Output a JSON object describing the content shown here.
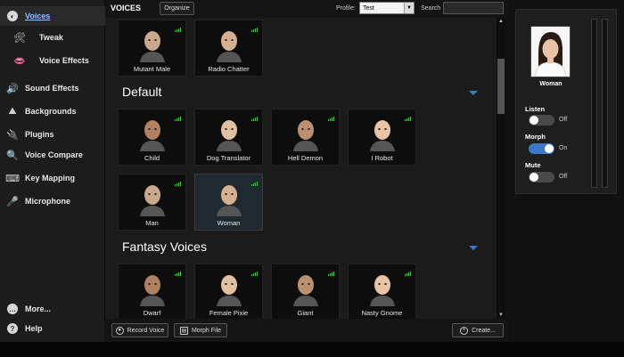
{
  "sidebar": {
    "items": [
      {
        "label": "Voices",
        "icon": "voices-icon",
        "active": true
      },
      {
        "label": "Tweak",
        "icon": "tools-icon"
      },
      {
        "label": "Voice Effects",
        "icon": "lips-icon"
      },
      {
        "label": "Sound Effects",
        "icon": "speaker-icon"
      },
      {
        "label": "Backgrounds",
        "icon": "landscape-icon"
      },
      {
        "label": "Plugins",
        "icon": "plug-icon"
      },
      {
        "label": "Voice Compare",
        "icon": "magnifier-icon"
      },
      {
        "label": "Key Mapping",
        "icon": "keyboard-icon"
      },
      {
        "label": "Microphone",
        "icon": "microphone-icon"
      },
      {
        "label": "More...",
        "icon": "more-icon"
      },
      {
        "label": "Help",
        "icon": "help-icon"
      }
    ]
  },
  "header": {
    "title": "VOICES",
    "organize_label": "Organize",
    "profile_label": "Profile:",
    "profile_value": "Test",
    "search_label": "Search",
    "search_value": ""
  },
  "sections": [
    {
      "title": "",
      "voices": [
        "Mutant Male",
        "Radio Chatter"
      ]
    },
    {
      "title": "Default",
      "voices": [
        "Child",
        "Dog Translator",
        "Hell Demon",
        "I Robot",
        "Man",
        "Woman"
      ]
    },
    {
      "title": "Fantasy Voices",
      "voices": [
        "Dwarf",
        "Female Pixie",
        "Giant",
        "Nasty Gnome"
      ]
    }
  ],
  "selected_voice": "Woman",
  "bottom": {
    "record_label": "Record Voice",
    "morph_file_label": "Morph File",
    "create_label": "Create..."
  },
  "right_panel": {
    "preview_name": "Woman",
    "listen_label": "Listen",
    "listen_state": "Off",
    "morph_label": "Morph",
    "morph_state": "On",
    "mute_label": "Mute",
    "mute_state": "Off"
  },
  "colors": {
    "accent": "#3c78c8",
    "signal": "#4cc24c",
    "active_nav_text": "#8fc4ff"
  }
}
